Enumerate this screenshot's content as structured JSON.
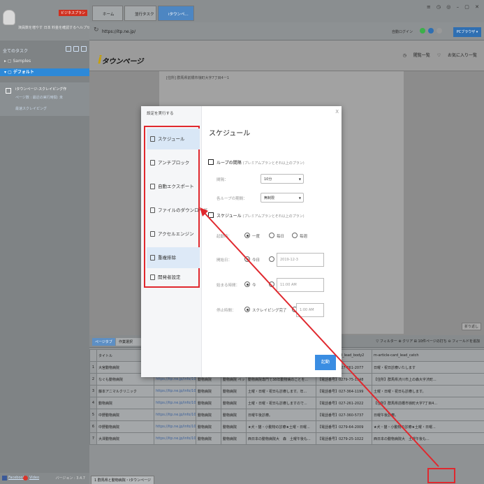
{
  "sidebar": {
    "pro_badge": "ビジネスプラン",
    "user_line": "演員数を増やす 日本 料金を確認するヘルプセンター",
    "tasks_title": "全てのタスク",
    "samples": "Samples",
    "default_group": "デフォルト",
    "task_name": "iタウンページ-スクレイピング作",
    "task_line2": "ページ数 : 最近の実行時間: 未",
    "task_line3": "最速スクレイピング",
    "footer_facebook": "Facebook",
    "footer_video": "Video",
    "footer_version": "バージョン : 3.4.7"
  },
  "browser": {
    "tabs": [
      "ホーム",
      "並行タスク",
      "iタウンペ..."
    ],
    "window_controls": "≡ ◷ ◎ – ▢ ✕",
    "url": "https://itp.ne.jp/",
    "login_text": "自動ログイン",
    "pc_button": "PCブラウザ ▾"
  },
  "page": {
    "logo_text": "タウンページ",
    "header_links": [
      "閲覧一覧",
      "お気に入り一覧"
    ],
    "article_line": "[住所] 群馬県前橋市嶺町大字7丁目4ー1",
    "scroll_hint": "折り返し"
  },
  "dialog": {
    "title": "設定を実行する",
    "close": "X",
    "heading": "スケジュール",
    "menu": [
      {
        "label": "スケジュール",
        "icon": "clock-icon"
      },
      {
        "label": "アンチブロック",
        "icon": "shield-icon"
      },
      {
        "label": "自動エクスポート",
        "icon": "export-icon"
      },
      {
        "label": "ファイルのダウンロード",
        "icon": "file-download-icon"
      },
      {
        "label": "アクセルエンジン",
        "icon": "engine-icon"
      },
      {
        "label": "重複排除",
        "icon": "dedupe-icon"
      },
      {
        "label": "開発者設定",
        "icon": "gear-icon"
      }
    ],
    "loop_label": "ループの間隔",
    "loop_sub": "(プレミアムプランとそれ以上のプラン)",
    "interval_label": "間隔：",
    "interval_value": "10分",
    "each_loop_label": "各ループの期間：",
    "each_loop_value": "無制限",
    "schedule_label": "スケジュール",
    "schedule_sub": "(プレミアムプランとそれ以上のプラン)",
    "start_type_label": "起動時：",
    "radio_once": "一度",
    "radio_daily": "毎日",
    "radio_weekly": "毎週",
    "start_date_label": "開始日：",
    "start_date_radio": "今日",
    "start_date_value": "2019-12-3",
    "start_time_label": "始まる時間：",
    "start_time_radio": "今",
    "start_time_value": "11:00 AM",
    "stop_time_label": "停止時間：",
    "stop_time_radio": "スクレイピング完了",
    "stop_time_value": "1:00 AM",
    "start_button": "起動"
  },
  "data_preview": {
    "mode_label": "ページタブ",
    "select_label": "作業選択",
    "right_tools": "▽ フィルター  ⊕ クリア  ⊞ 10件ページの打ち  ⊖ フィールドを追加",
    "columns": [
      "",
      "タイトル",
      "",
      "",
      "",
      "m-article-card_lead_body1",
      "m-article-card_lead_body2",
      "m-article-card_lead_catch"
    ],
    "rows": [
      [
        "1",
        "大宮動物病院",
        "",
        "",
        "",
        "",
        "【電話番号】027-261-2077",
        "日曜・祝日診療いたします"
      ],
      [
        "2",
        "なぐも動物病院",
        "https://itp.ne.jp/info/1060541500000",
        "動物病院",
        "動物病院 ペットショップ",
        "動物病院専門で38年動物病のことを...",
        "【電話番号】0279-75-1948",
        "【住所】群馬県渋川市上の森大字渋町..."
      ],
      [
        "3",
        "藤本アニマルクリニック",
        "https://itp.ne.jp/info/1060537060000",
        "動物病院",
        "動物病院",
        "土曜・日曜・祝日も診療します。年...",
        "【電話番号】027-364-1199",
        "土曜・日曜・祝日も診療します。"
      ],
      [
        "4",
        "動物病院",
        "https://itp.ne.jp/info/1064652540000",
        "動物病院",
        "動物病院",
        "土曜・日曜・祝日も診療しますので...",
        "【電話番号】027-261-2022",
        "【住所】群馬県前橋市嶺町大字7丁目4..."
      ],
      [
        "5",
        "中野動物病院",
        "https://itp.ne.jp/info/1062864310000",
        "動物病院",
        "動物病院",
        "日曜午後診療。",
        "【電話番号】027-360-5737",
        "日曜午後診療。"
      ],
      [
        "6",
        "中野動物病院",
        "https://itp.ne.jp/info/1059160490000",
        "動物病院",
        "動物病院",
        "★犬・猫・小動物の診療★土曜・日曜...",
        "【電話番号】0279-64-2009",
        "★犬・猫・小動物の診療★土曜・日曜..."
      ],
      [
        "7",
        "大澤動物病院",
        "https://itp.ne.jp/info/1061775840000",
        "動物病院",
        "動物病院",
        "西日本の動物病院大　森　土曜午後も...",
        "【電話番号】0279-25-1022",
        "西日本の動物病院大　土曜午後も..."
      ]
    ],
    "file_tab": "1 群馬県と動物病院・iタウンページ",
    "run_button": "起動",
    "save_button": "保存"
  }
}
